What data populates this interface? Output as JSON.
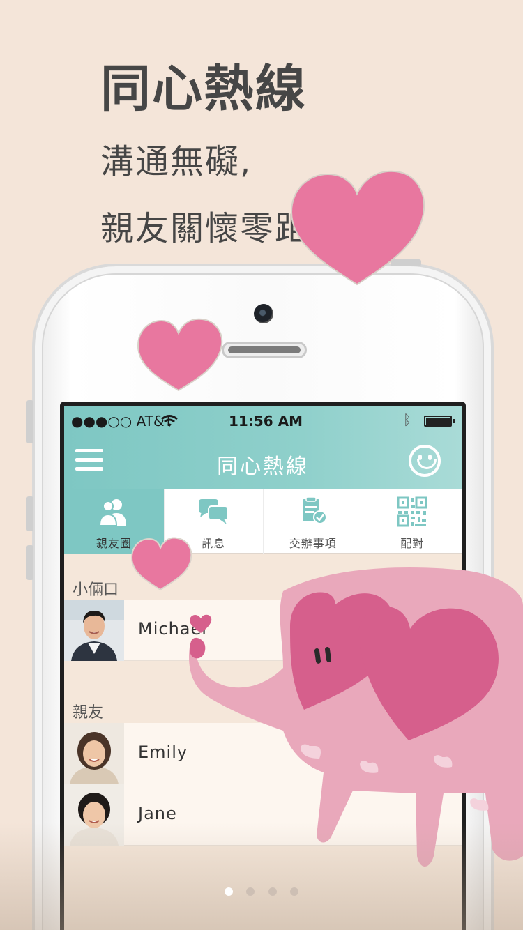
{
  "promo": {
    "headline": "同心熱線",
    "subline1": "溝通無礙,",
    "subline2": "親友關懷零距離"
  },
  "status_bar": {
    "carrier": "●●●○○ AT&T",
    "time": "11:56 AM",
    "wifi_icon": "wifi-icon",
    "bluetooth_icon": "bluetooth-icon",
    "battery_icon": "battery-icon"
  },
  "navbar": {
    "title": "同心熱線",
    "menu_icon": "hamburger-menu-icon",
    "profile_icon": "smiley-face-icon"
  },
  "tabs": [
    {
      "label": "親友圈",
      "icon": "people-icon",
      "active": true
    },
    {
      "label": "訊息",
      "icon": "chat-bubbles-icon",
      "active": false
    },
    {
      "label": "交辦事項",
      "icon": "task-document-icon",
      "active": false
    },
    {
      "label": "配對",
      "icon": "qr-code-icon",
      "active": false
    }
  ],
  "sections": [
    {
      "label": "小倆口",
      "contacts": [
        {
          "name": "Michael"
        }
      ]
    },
    {
      "label": "親友",
      "contacts": [
        {
          "name": "Emily"
        },
        {
          "name": "Jane"
        }
      ]
    }
  ],
  "pagination": {
    "count": 4,
    "active_index": 0
  },
  "colors": {
    "background": "#f4e5d9",
    "accent_teal": "#7ec7c3",
    "heart_pink": "#e8779f",
    "elephant_pink": "#e9a8bb",
    "elephant_heart": "#d65f8c",
    "text_dark": "#464646"
  }
}
